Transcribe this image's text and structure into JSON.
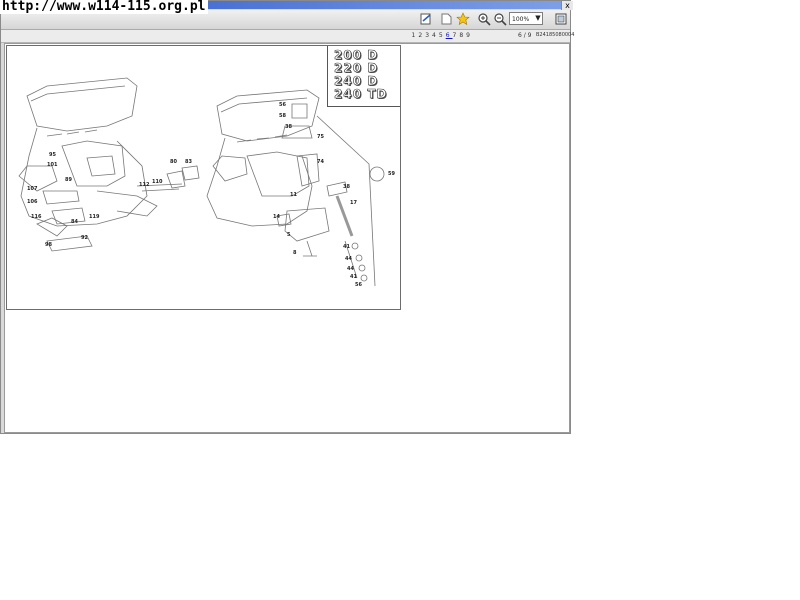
{
  "watermark": {
    "url": "http://www.w114-115.org.pl"
  },
  "window": {
    "close_label": "x"
  },
  "toolbar": {
    "zoom_value": "100%",
    "zoom_arrow": "▼"
  },
  "pagebar": {
    "pages": [
      "1",
      "2",
      "3",
      "4",
      "5",
      "6",
      "7",
      "8",
      "9"
    ],
    "active_page": "6",
    "page_count": "6 / 9",
    "doc_code": "B24185080004"
  },
  "diagram": {
    "models": [
      "200 D",
      "220 D",
      "240 D",
      "240 TD"
    ],
    "callouts": [
      "95",
      "101",
      "89",
      "107",
      "106",
      "116",
      "84",
      "119",
      "92",
      "98",
      "112",
      "110",
      "80",
      "83",
      "56",
      "58",
      "38",
      "75",
      "74",
      "59",
      "38",
      "17",
      "11",
      "14",
      "5",
      "41",
      "44",
      "44",
      "41",
      "56",
      "8"
    ]
  }
}
